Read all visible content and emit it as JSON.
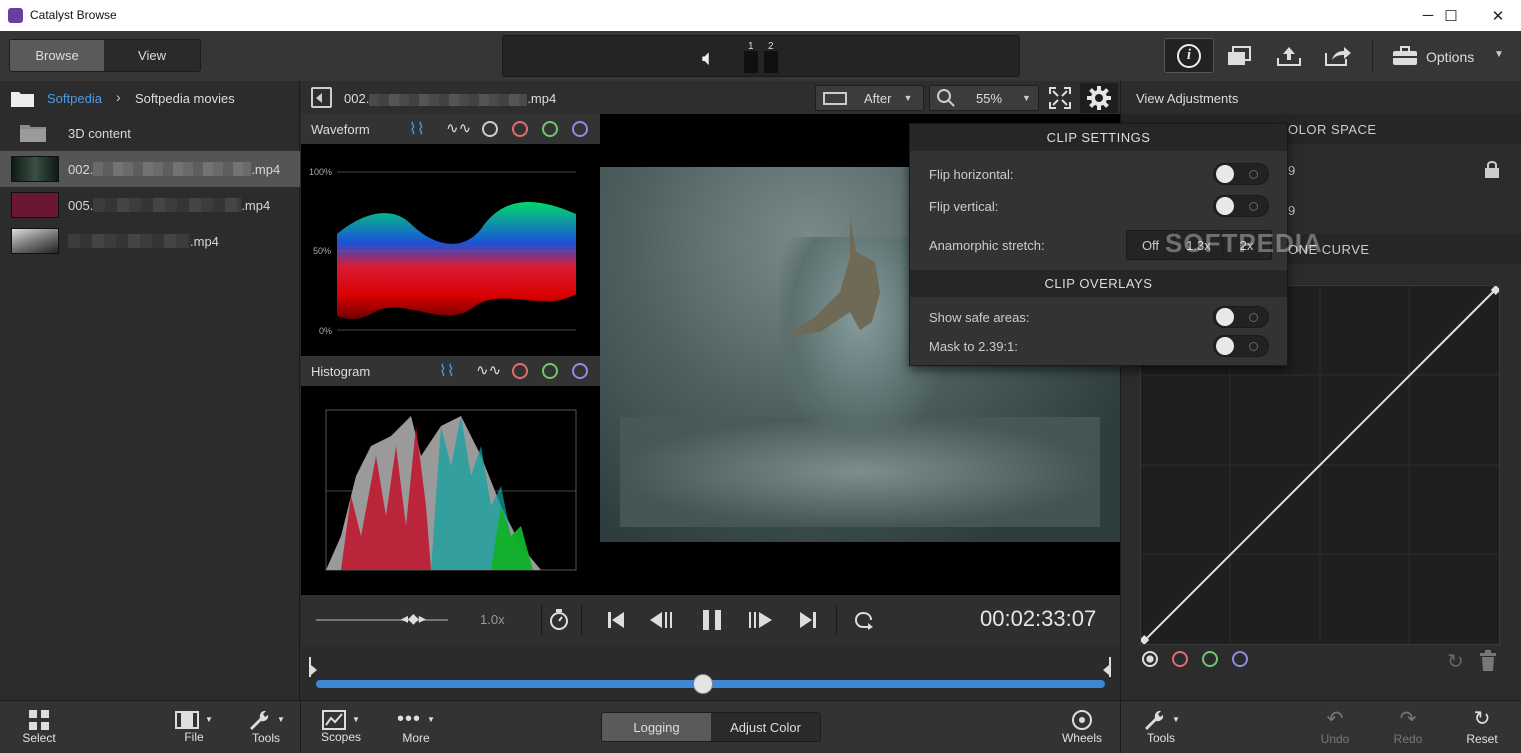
{
  "window": {
    "title": "Catalyst Browse",
    "controls": [
      "─",
      "☐",
      "✕"
    ]
  },
  "topbar": {
    "mode_tabs": [
      "Browse",
      "View"
    ],
    "channels": [
      "1",
      "2"
    ],
    "options_label": "Options"
  },
  "browser": {
    "breadcrumb": [
      "Softpedia",
      "Softpedia movies"
    ],
    "items": [
      {
        "name": "3D content",
        "type": "folder"
      },
      {
        "name": "002.mp4",
        "prefix": "002.",
        "suffix": ".mp4",
        "selected": true
      },
      {
        "name": "005.mp4",
        "prefix": "005.",
        "suffix": ".mp4",
        "selected": false
      },
      {
        "name": ".mp4",
        "prefix": "",
        "suffix": ".mp4",
        "selected": false
      }
    ]
  },
  "clip": {
    "filename_prefix": "002.",
    "filename_suffix": ".mp4",
    "view_mode": "After",
    "zoom": "55%"
  },
  "scopes": {
    "waveform_title": "Waveform",
    "waveform_labels": [
      "100%",
      "50%",
      "0%"
    ],
    "histogram_title": "Histogram"
  },
  "transport": {
    "speed": "1.0x",
    "timecode": "00:02:33:07",
    "playhead_fraction": 0.49
  },
  "adjustments": {
    "title": "View Adjustments",
    "section_color_space": "OLOR SPACE",
    "row_suffix_1": "9",
    "row_suffix_2": "9",
    "section_tone_curve": "ONE CURVE"
  },
  "popup": {
    "clip_settings": "CLIP SETTINGS",
    "flip_horizontal": "Flip horizontal:",
    "flip_vertical": "Flip vertical:",
    "anamorphic": "Anamorphic stretch:",
    "stretch_options": [
      "Off",
      "1.3x",
      "2x"
    ],
    "clip_overlays": "CLIP OVERLAYS",
    "safe_areas": "Show safe areas:",
    "mask": "Mask to 2.39:1:"
  },
  "watermark": "SOFTPEDIA",
  "bottombar": {
    "select": "Select",
    "file": "File",
    "tools": "Tools",
    "scopes": "Scopes",
    "more": "More",
    "tabs": [
      "Logging",
      "Adjust Color"
    ],
    "wheels": "Wheels",
    "tools_right": "Tools",
    "undo": "Undo",
    "redo": "Redo",
    "reset": "Reset"
  },
  "colors": {
    "accent": "#3d87d6",
    "selected_row": "#555555",
    "panel": "#2c2c2c"
  }
}
